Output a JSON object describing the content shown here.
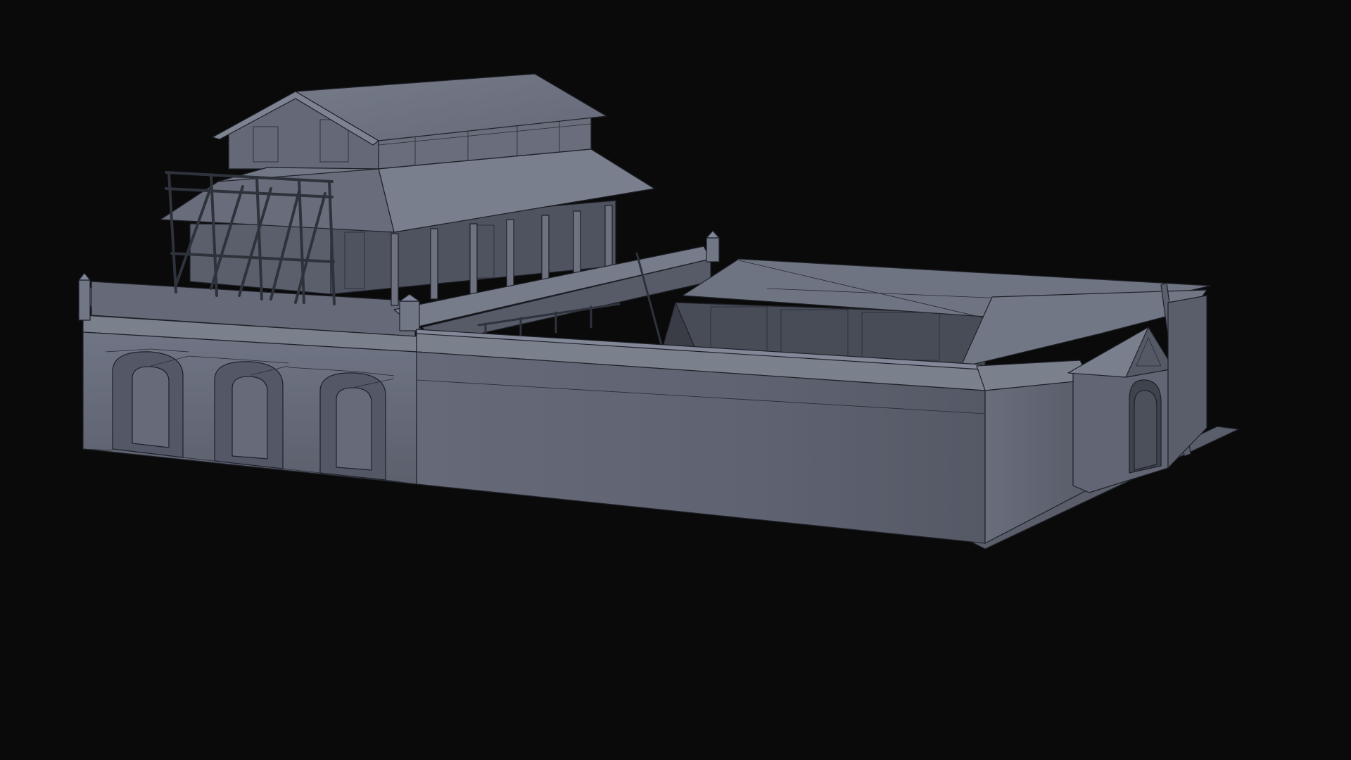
{
  "scene": {
    "description_type": "3d-clay-render",
    "background_color": "#0a0a0a",
    "model_base_color": "#6b7080",
    "model_shadow_color": "#454954",
    "model_highlight_color": "#8a8f9c",
    "wire_color": "#1e2128"
  }
}
